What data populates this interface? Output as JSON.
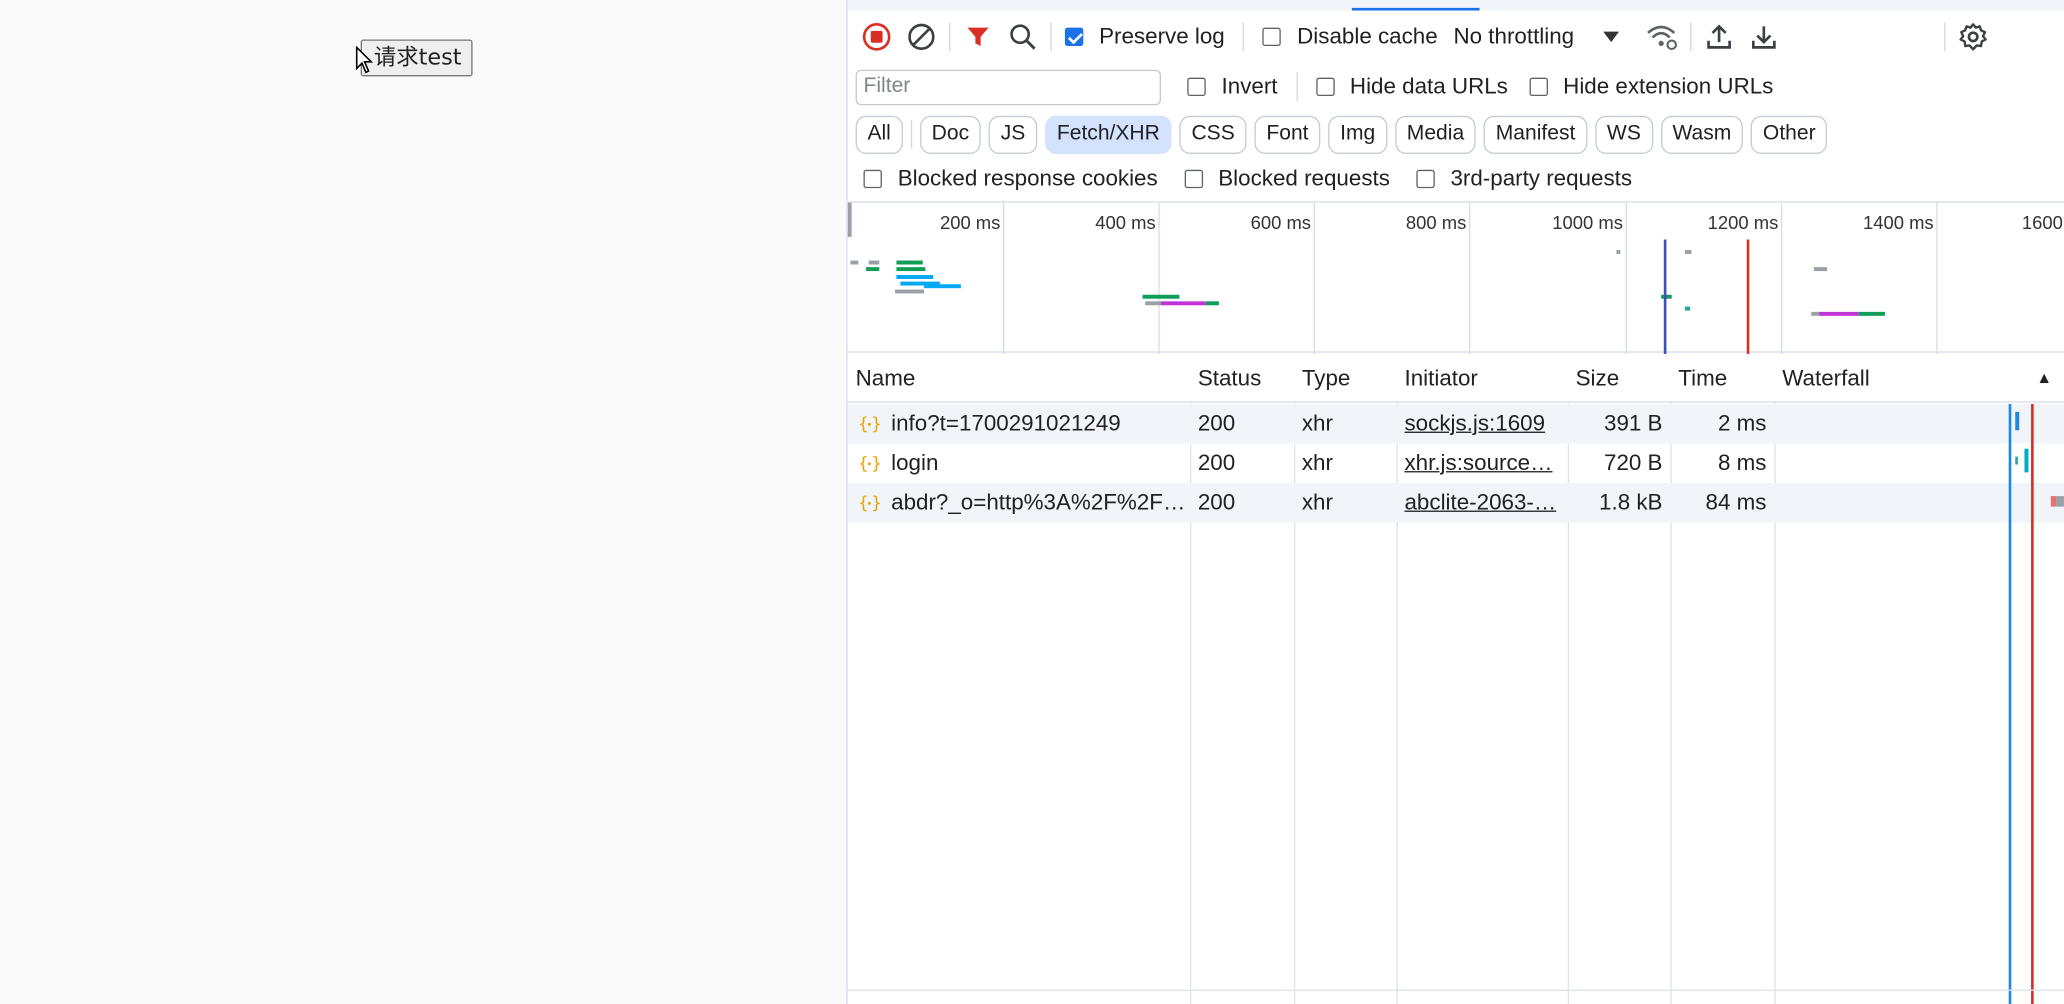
{
  "page": {
    "button_label": "请求test"
  },
  "devtools": {
    "toolbar": {
      "preserve_log_label": "Preserve log",
      "preserve_log_checked": true,
      "disable_cache_label": "Disable cache",
      "disable_cache_checked": false,
      "throttling_value": "No throttling",
      "icons": [
        "stop-recording-icon",
        "clear-icon",
        "filter-icon",
        "search-icon",
        "network-conditions-icon",
        "import-har-icon",
        "export-har-icon",
        "settings-icon"
      ]
    },
    "filter_bar": {
      "placeholder": "Filter",
      "invert_label": "Invert",
      "hide_data_urls_label": "Hide data URLs",
      "hide_extension_urls_label": "Hide extension URLs"
    },
    "type_filters": [
      "All",
      "Doc",
      "JS",
      "Fetch/XHR",
      "CSS",
      "Font",
      "Img",
      "Media",
      "Manifest",
      "WS",
      "Wasm",
      "Other"
    ],
    "active_type_filter": "Fetch/XHR",
    "blocked_bar": {
      "blocked_response_cookies_label": "Blocked response cookies",
      "blocked_requests_label": "Blocked requests",
      "third_party_label": "3rd-party requests"
    },
    "overview": {
      "tick_labels": [
        "200 ms",
        "400 ms",
        "600 ms",
        "800 ms",
        "1000 ms",
        "1200 ms",
        "1400 ms",
        "1600"
      ]
    },
    "table": {
      "columns": [
        "Name",
        "Status",
        "Type",
        "Initiator",
        "Size",
        "Time",
        "Waterfall"
      ],
      "sort_indicator": "▲",
      "rows": [
        {
          "name": "info?t=1700291021249",
          "status": "200",
          "type": "xhr",
          "initiator": "sockjs.js:1609",
          "size": "391 B",
          "time": "2 ms"
        },
        {
          "name": "login",
          "status": "200",
          "type": "xhr",
          "initiator": "xhr.js:source…",
          "size": "720 B",
          "time": "8 ms"
        },
        {
          "name": "abdr?_o=http%3A%2F%2F…",
          "status": "200",
          "type": "xhr",
          "initiator": "abclite-2063-…",
          "size": "1.8 kB",
          "time": "84 ms"
        }
      ]
    },
    "colors": {
      "accent": "#1a73e8",
      "record": "#d93025",
      "filter_active": "#d93025",
      "xhr_icon": "#e8a400",
      "active_pill": "#d3e3fd"
    }
  }
}
